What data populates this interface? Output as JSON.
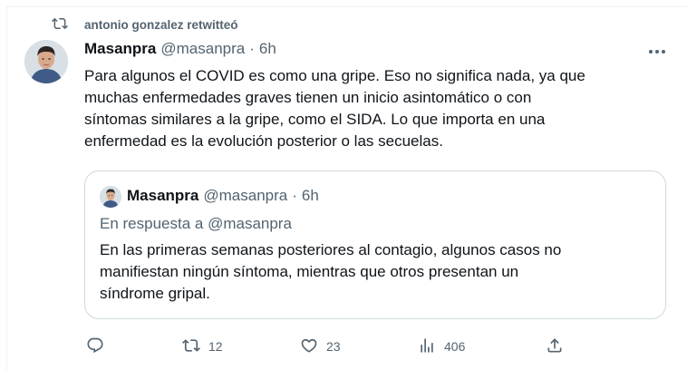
{
  "retweet_context": {
    "label": "antonio gonzalez retwitteó",
    "icon": "retweet-icon"
  },
  "tweet": {
    "author_name": "Masanpra",
    "author_handle": "@masanpra",
    "separator": "·",
    "time": "6h",
    "more_icon": "more-icon",
    "text_lines": [
      "Para algunos el COVID es como una gripe. Eso no significa nada, ya que",
      "muchas enfermedades graves tienen un inicio asintomático o con",
      "síntomas similares a la gripe, como el SIDA. Lo que importa en una",
      "enfermedad es la evolución posterior o las secuelas."
    ]
  },
  "quoted_tweet": {
    "author_name": "Masanpra",
    "author_handle": "@masanpra",
    "separator": "·",
    "time": "6h",
    "reply_context": "En respuesta a @masanpra",
    "text_lines": [
      "En las primeras semanas posteriores al contagio, algunos casos no",
      "manifiestan ningún síntoma, mientras que otros presentan un",
      "síndrome gripal."
    ]
  },
  "actions": {
    "reply_count": "",
    "retweet_count": "12",
    "like_count": "23",
    "views_count": "406"
  },
  "colors": {
    "text_primary": "#0f1419",
    "text_secondary": "#536471",
    "border": "#cfd9de"
  }
}
